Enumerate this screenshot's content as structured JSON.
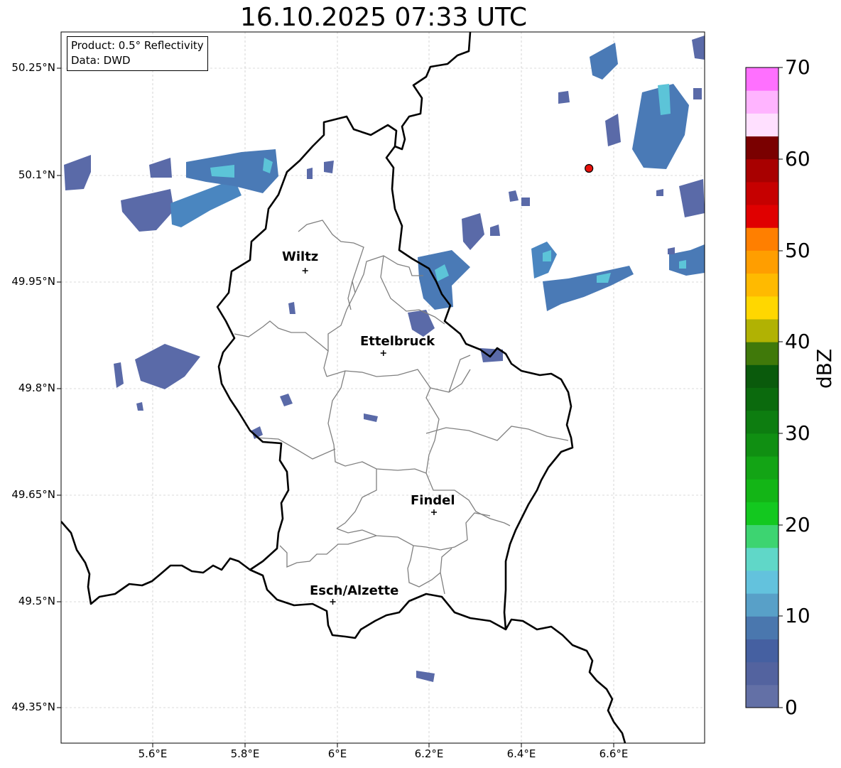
{
  "title": "16.10.2025 07:33 UTC",
  "info_box": {
    "product": "Product: 0.5° Reflectivity",
    "data_source": "Data: DWD"
  },
  "axes": {
    "lat_ticks": [
      "50.25°N",
      "50.1°N",
      "49.95°N",
      "49.8°N",
      "49.65°N",
      "49.5°N",
      "49.35°N"
    ],
    "lon_ticks": [
      "5.6°E",
      "5.8°E",
      "6°E",
      "6.2°E",
      "6.4°E",
      "6.6°E"
    ]
  },
  "cities": [
    {
      "name": "Wiltz",
      "lon": 5.93,
      "lat": 49.966
    },
    {
      "name": "Ettelbruck",
      "lon": 6.1,
      "lat": 49.85
    },
    {
      "name": "Findel",
      "lon": 6.21,
      "lat": 49.626
    },
    {
      "name": "Esch/Alzette",
      "lon": 5.99,
      "lat": 49.5
    }
  ],
  "radar_site_marker": {
    "lon": 6.547,
    "lat": 50.11,
    "color": "#e8120c"
  },
  "colorbar": {
    "label": "dBZ",
    "min": 0,
    "max": 70,
    "step": 2.5,
    "tick_labels": [
      "0",
      "10",
      "20",
      "30",
      "40",
      "50",
      "60",
      "70"
    ],
    "colors": [
      "#6370a6",
      "#53639f",
      "#4560a1",
      "#4a77ae",
      "#58a0c8",
      "#63c2dd",
      "#60d7c8",
      "#3dd471",
      "#13c81f",
      "#13b516",
      "#13a415",
      "#108f12",
      "#0d7d10",
      "#0b6a0d",
      "#0a5a0c",
      "#40790a",
      "#b1b203",
      "#ffd700",
      "#ffba00",
      "#ff9e00",
      "#ff7f00",
      "#e00000",
      "#c60000",
      "#a80000",
      "#7a0000",
      "#ffe0ff",
      "#ffb4ff",
      "#ff70ff",
      "#e73ce9"
    ]
  },
  "colors": {
    "national_border": "#000000",
    "canton_border": "#808080",
    "echo_low": "#5a6aa8",
    "echo_mid": "#4a86c0",
    "echo_high": "#5cc4d8"
  }
}
